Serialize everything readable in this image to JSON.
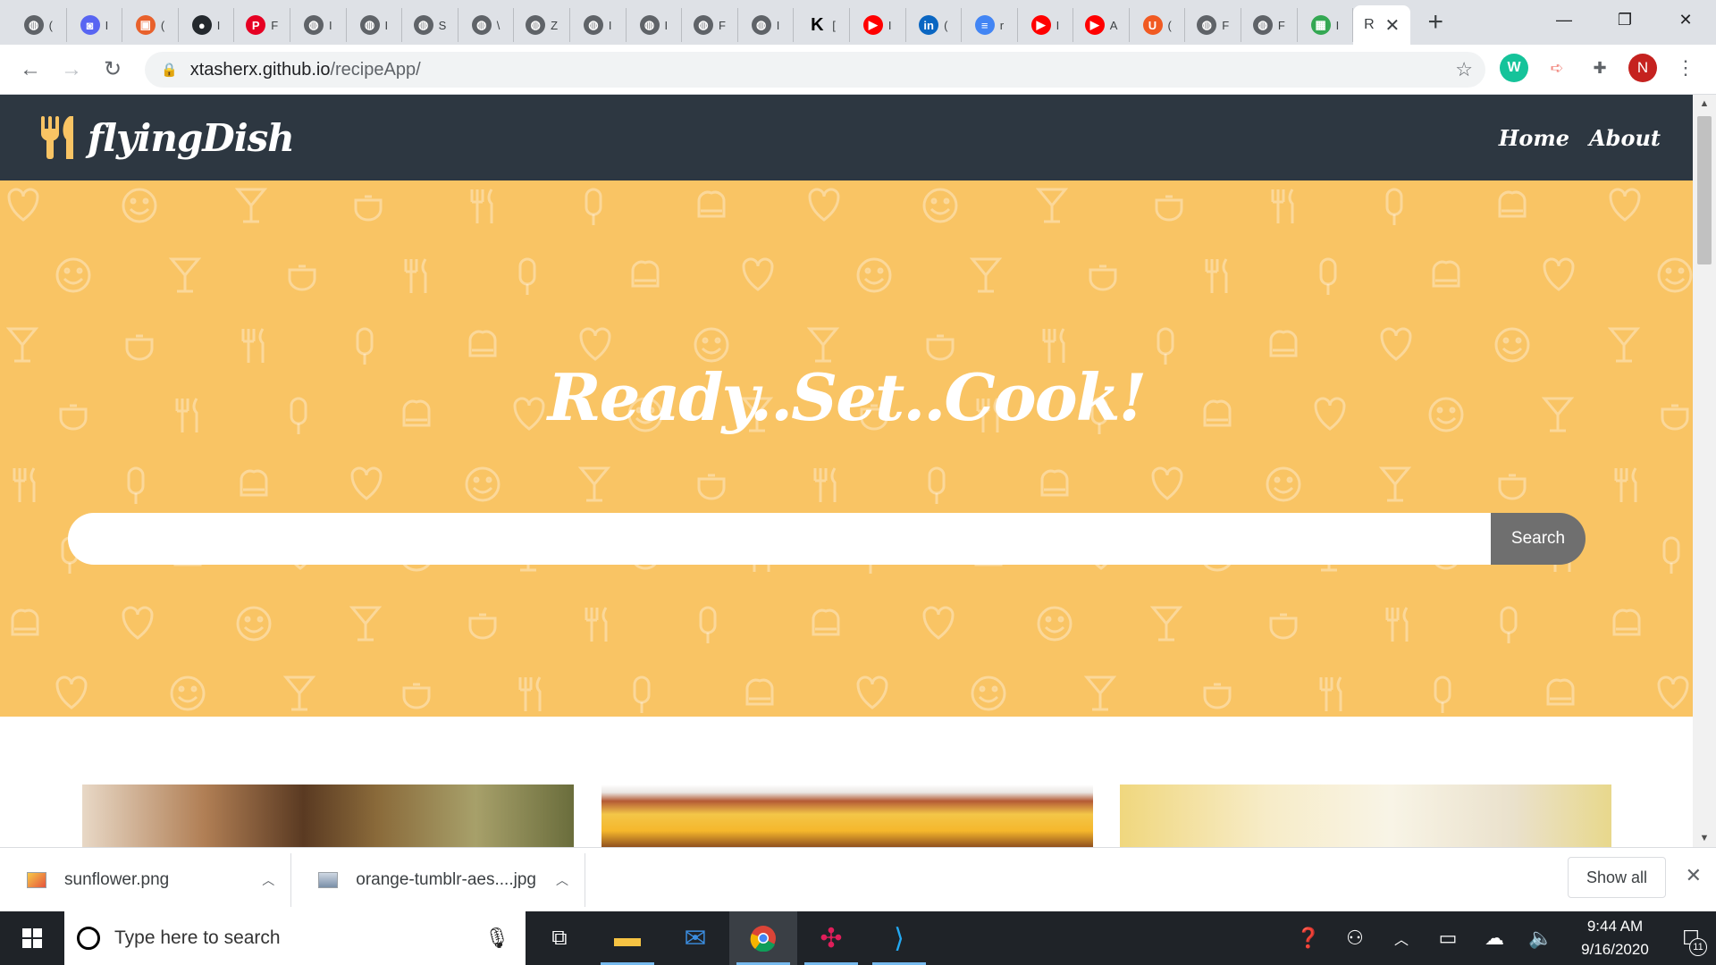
{
  "browser": {
    "tabs": [
      {
        "favicon": "chrome-default-icon",
        "label": "(",
        "color": "#5f6368"
      },
      {
        "favicon": "discord-icon",
        "label": "I",
        "color": "#5865f2"
      },
      {
        "favicon": "shopping-bag-icon",
        "label": "(",
        "color": "#e8612c"
      },
      {
        "favicon": "github-icon",
        "label": "I",
        "color": "#24292e"
      },
      {
        "favicon": "pinterest-icon",
        "label": "F",
        "color": "#e60023"
      },
      {
        "favicon": "chrome-default-icon",
        "label": "I",
        "color": "#5f6368"
      },
      {
        "favicon": "chrome-default-icon",
        "label": "I",
        "color": "#5f6368"
      },
      {
        "favicon": "chrome-default-icon",
        "label": "S",
        "color": "#5f6368"
      },
      {
        "favicon": "chrome-default-icon",
        "label": "\\",
        "color": "#5f6368"
      },
      {
        "favicon": "chrome-default-icon",
        "label": "Z",
        "color": "#5f6368"
      },
      {
        "favicon": "chrome-default-icon",
        "label": "I",
        "color": "#5f6368"
      },
      {
        "favicon": "chrome-default-icon",
        "label": "I",
        "color": "#5f6368"
      },
      {
        "favicon": "chrome-default-icon",
        "label": "F",
        "color": "#5f6368"
      },
      {
        "favicon": "chrome-default-icon",
        "label": "I",
        "color": "#5f6368"
      },
      {
        "favicon": "k-icon",
        "label": "[",
        "color": "#000000"
      },
      {
        "favicon": "youtube-icon",
        "label": "I",
        "color": "#ff0000"
      },
      {
        "favicon": "linkedin-icon",
        "label": "(",
        "color": "#0a66c2"
      },
      {
        "favicon": "docs-icon",
        "label": "r",
        "color": "#4285f4"
      },
      {
        "favicon": "youtube-icon",
        "label": "I",
        "color": "#ff0000"
      },
      {
        "favicon": "youtube-icon",
        "label": "A",
        "color": "#ff0000"
      },
      {
        "favicon": "utsa-icon",
        "label": "(",
        "color": "#f15a22"
      },
      {
        "favicon": "chrome-default-icon",
        "label": "F",
        "color": "#5f6368"
      },
      {
        "favicon": "chrome-default-icon",
        "label": "F",
        "color": "#5f6368"
      },
      {
        "favicon": "sheets-icon",
        "label": "I",
        "color": "#34a853"
      }
    ],
    "active_tab": {
      "label": "R",
      "close_glyph": "✕"
    },
    "new_tab_glyph": "+",
    "window_controls": {
      "minimize": "—",
      "restore": "❐",
      "close": "✕"
    },
    "nav": {
      "back": "←",
      "forward": "→",
      "reload": "↻"
    },
    "url_host": "xtasherx.github.io",
    "url_path": "/recipeApp/",
    "lock_glyph": "🔒",
    "bookmark_glyph": "☆",
    "avatar_initial": "N"
  },
  "site": {
    "brand": "flyingDish",
    "nav_links": [
      "Home",
      "About"
    ],
    "hero_title": "Ready..Set..Cook!",
    "search_placeholder": "",
    "search_button": "Search",
    "colors": {
      "navbar": "#2d3741",
      "hero": "#f9c464",
      "logo_icon": "#f9c464",
      "search_button": "#6f6f6f"
    }
  },
  "downloads": {
    "items": [
      {
        "name": "sunflower.png"
      },
      {
        "name": "orange-tumblr-aes....jpg"
      }
    ],
    "show_all": "Show all",
    "close_glyph": "✕"
  },
  "taskbar": {
    "search_placeholder": "Type here to search",
    "time": "9:44 AM",
    "date": "9/16/2020",
    "notification_count": "11",
    "apps": [
      "task-view-icon",
      "file-explorer-icon",
      "mail-icon",
      "chrome-icon",
      "slack-icon",
      "vscode-icon"
    ]
  }
}
